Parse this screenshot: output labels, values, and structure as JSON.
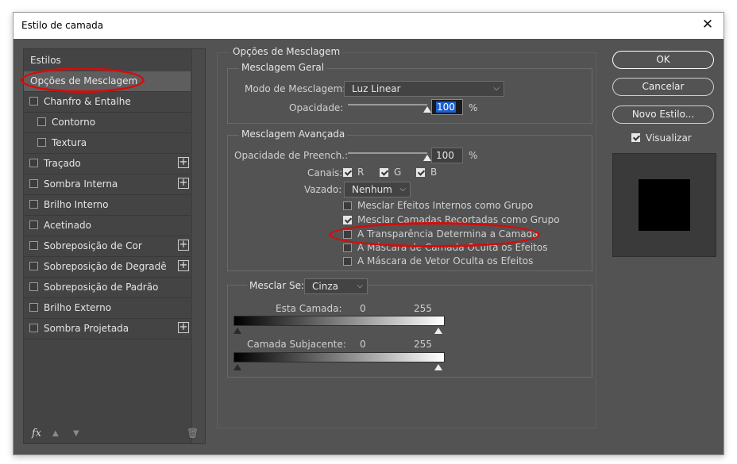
{
  "window": {
    "title": "Estilo de camada",
    "close_glyph": "✕"
  },
  "sidebar": {
    "header": "Estilos",
    "items": [
      {
        "label": "Opções de Mesclagem",
        "checkbox": false,
        "plus": false,
        "selected": true
      },
      {
        "label": "Chanfro & Entalhe",
        "checkbox": true,
        "plus": false,
        "checked": false
      },
      {
        "label": "Contorno",
        "checkbox": true,
        "plus": false,
        "indent": true,
        "checked": false
      },
      {
        "label": "Textura",
        "checkbox": true,
        "plus": false,
        "indent": true,
        "checked": false
      },
      {
        "label": "Traçado",
        "checkbox": true,
        "plus": true,
        "checked": false
      },
      {
        "label": "Sombra Interna",
        "checkbox": true,
        "plus": true,
        "checked": false
      },
      {
        "label": "Brilho Interno",
        "checkbox": true,
        "plus": false,
        "checked": false
      },
      {
        "label": "Acetinado",
        "checkbox": true,
        "plus": false,
        "checked": false
      },
      {
        "label": "Sobreposição de Cor",
        "checkbox": true,
        "plus": true,
        "checked": false
      },
      {
        "label": "Sobreposição de Degradê",
        "checkbox": true,
        "plus": true,
        "checked": false
      },
      {
        "label": "Sobreposição de Padrão",
        "checkbox": true,
        "plus": false,
        "checked": false
      },
      {
        "label": "Brilho Externo",
        "checkbox": true,
        "plus": false,
        "checked": false
      },
      {
        "label": "Sombra Projetada",
        "checkbox": true,
        "plus": true,
        "checked": false
      }
    ],
    "plus_glyph": "+",
    "bottom_icons": {
      "fx": "fx",
      "up": "▲",
      "down": "▼",
      "trash": "🗑"
    }
  },
  "blending": {
    "title": "Opções de Mesclagem",
    "general": {
      "title": "Mesclagem Geral",
      "mode_label": "Modo de Mesclagem:",
      "mode_value": "Luz Linear",
      "opacity_label": "Opacidade:",
      "opacity_value": "100",
      "opacity_unit": "%",
      "opacity_level": 1.0
    },
    "advanced": {
      "title": "Mesclagem Avançada",
      "fill_label": "Opacidade de Preench.:",
      "fill_value": "100",
      "fill_unit": "%",
      "fill_level": 1.0,
      "channels_label": "Canais:",
      "channel_r": "R",
      "channel_g": "G",
      "channel_b": "B",
      "knockout_label": "Vazado:",
      "knockout_value": "Nenhum",
      "options": [
        {
          "label": "Mesclar Efeitos Internos como Grupo",
          "checked": false
        },
        {
          "label": "Mesclar Camadas Recortadas como Grupo",
          "checked": true
        },
        {
          "label": "A Transparência Determina a Camada",
          "checked": false
        },
        {
          "label": "A Máscara de Camada Oculta os Efeitos",
          "checked": false
        },
        {
          "label": "A Máscara de Vetor Oculta os Efeitos",
          "checked": false
        }
      ]
    },
    "blend_if": {
      "label": "Mesclar Se:",
      "value": "Cinza",
      "this_layer_label": "Esta Camada:",
      "this_min": "0",
      "this_max": "255",
      "underlying_label": "Camada Subjacente:",
      "under_min": "0",
      "under_max": "255"
    }
  },
  "buttons": {
    "ok": "OK",
    "cancel": "Cancelar",
    "new_style": "Novo Estilo...",
    "preview_label": "Visualizar",
    "preview_checked": true
  },
  "colors": {
    "annotation": "#d60c0c",
    "dialog_bg": "#535353",
    "selection": "#1c5fd0"
  }
}
